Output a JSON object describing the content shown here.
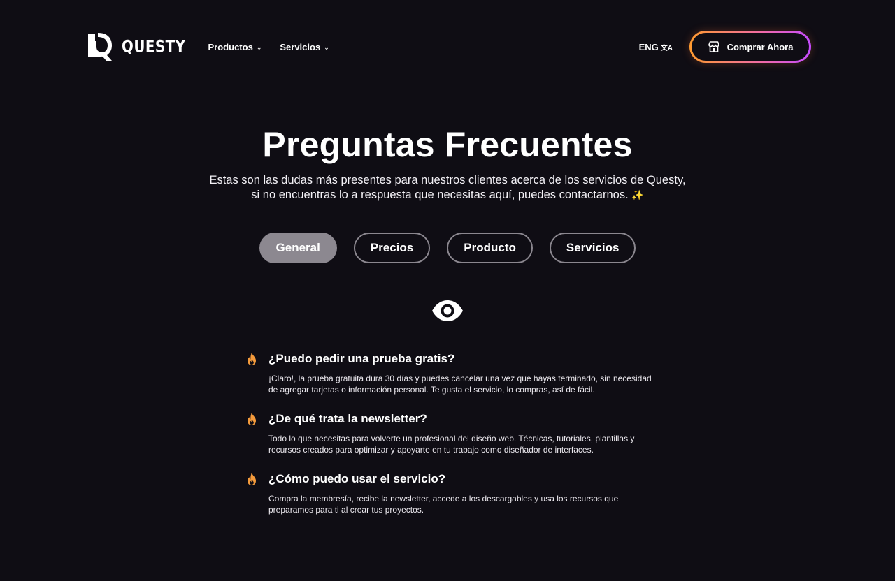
{
  "nav": {
    "logo_text": "QUESTY",
    "links": [
      {
        "label": "Productos",
        "icon": "chevron-down-icon"
      },
      {
        "label": "Servicios",
        "icon": "chevron-down-icon"
      }
    ],
    "language": "ENG",
    "language_icon": "translate-icon",
    "cta_label": "Comprar Ahora",
    "cta_icon": "store-icon"
  },
  "hero": {
    "title": "Preguntas Frecuentes",
    "subtitle_line1": "Estas son las dudas más presentes para nuestros clientes acerca de los servicios de Questy,",
    "subtitle_line2": "si no encuentras lo a respuesta que necesitas aquí, puedes contactarnos.",
    "sparkle": "✨"
  },
  "tabs": [
    {
      "label": "General",
      "active": true
    },
    {
      "label": "Precios",
      "active": false
    },
    {
      "label": "Producto",
      "active": false
    },
    {
      "label": "Servicios",
      "active": false
    }
  ],
  "section_icon": "eye-icon",
  "faq": [
    {
      "question": "¿Puedo pedir una prueba gratis?",
      "answer": "¡Claro!, la prueba gratuita dura 30 días y puedes cancelar una vez que hayas terminado, sin necesidad de agregar tarjetas o información personal. Te gusta el servicio, lo compras, así de fácil.",
      "icon": "flame-icon"
    },
    {
      "question": "¿De qué trata la newsletter?",
      "answer": "Todo lo que necesitas para volverte un profesional del diseño web. Técnicas, tutoriales, plantillas y recursos creados para optimizar y apoyarte en tu trabajo como diseñador de interfaces.",
      "icon": "flame-icon"
    },
    {
      "question": "¿Cómo puedo usar el servicio?",
      "answer": "Compra la membresía, recibe la newsletter, accede a los descargables y usa los recursos que preparamos para ti al crear tus proyectos.",
      "icon": "flame-icon"
    }
  ],
  "colors": {
    "background": "#0f0d14",
    "cta_gradient_start": "#ff9b2f",
    "cta_gradient_end": "#c54cff",
    "tab_active": "#8c8890",
    "flame": "#f39a3c"
  }
}
